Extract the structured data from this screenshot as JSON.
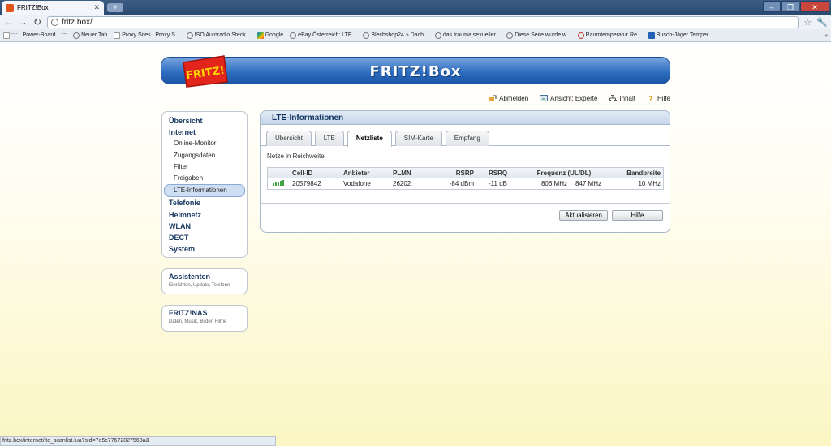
{
  "browser": {
    "tab_title": "FRITZ!Box",
    "tab_close": "✕",
    "url": "fritz.box/",
    "window_buttons": [
      "–",
      "❐",
      "✕"
    ],
    "bookmarks": [
      {
        "label": "::::...Power-Board....:::",
        "icon": "sq"
      },
      {
        "label": "Neuer Tab",
        "icon": "globe"
      },
      {
        "label": "Proxy Sites | Proxy S...",
        "icon": "sq"
      },
      {
        "label": "ISO Autoradio Steck...",
        "icon": "globe"
      },
      {
        "label": "Google",
        "icon": "g"
      },
      {
        "label": "eBay Österreich: LTE...",
        "icon": "ebay"
      },
      {
        "label": "Blechshop24 » Dach...",
        "icon": "globe"
      },
      {
        "label": "das trauma sexueller...",
        "icon": "globe"
      },
      {
        "label": "Diese Seite wurde w...",
        "icon": "globe"
      },
      {
        "label": "Raumtemperatur Re...",
        "icon": "r"
      },
      {
        "label": "Busch-Jäger Temper...",
        "icon": "b"
      }
    ],
    "bookmarks_more": "»",
    "status_url": "fritz.box/internet/lte_scanlist.lua?sid=7e5c77672827563a&"
  },
  "header": {
    "logo_text": "FRITZ!",
    "title": "FRITZ!Box",
    "links": {
      "abmelden": "Abmelden",
      "ansicht": "Ansicht: Experte",
      "inhalt": "Inhalt",
      "hilfe": "Hilfe"
    }
  },
  "sidebar": {
    "uebersicht": "Übersicht",
    "internet": "Internet",
    "internet_items": [
      "Online-Monitor",
      "Zugangsdaten",
      "Filter",
      "Freigaben",
      "LTE-Informationen"
    ],
    "telefonie": "Telefonie",
    "heimnetz": "Heimnetz",
    "wlan": "WLAN",
    "dect": "DECT",
    "system": "System",
    "assistenten_title": "Assistenten",
    "assistenten_sub": "Einrichten, Update, Telefone",
    "nas_title": "FRITZ!NAS",
    "nas_sub": "Daten, Musik, Bilder, Filme"
  },
  "content": {
    "title": "LTE-Informationen",
    "tabs": [
      "Übersicht",
      "LTE",
      "Netzliste",
      "SIM-Karte",
      "Empfang"
    ],
    "active_tab": "Netzliste",
    "section_label": "Netze in Reichweite",
    "table": {
      "headers": [
        "Cell-ID",
        "Anbieter",
        "PLMN",
        "RSRP",
        "RSRQ",
        "Frequenz (UL/DL)",
        "Bandbreite"
      ],
      "rows": [
        {
          "signal_bars": 5,
          "cell_id": "20579842",
          "anbieter": "Vodafone",
          "plmn": "26202",
          "rsrp": "-84 dBm",
          "rsrq": "-11 dB",
          "freq_ul": "806 MHz",
          "freq_dl": "847 MHz",
          "bandbreite": "10 MHz"
        }
      ]
    },
    "buttons": {
      "refresh": "Aktualisieren",
      "help": "Hilfe"
    }
  },
  "colors": {
    "banner": "#2f6ec2",
    "accent_nav": "#16365e",
    "page_bg_bottom": "#fbf6c3"
  }
}
